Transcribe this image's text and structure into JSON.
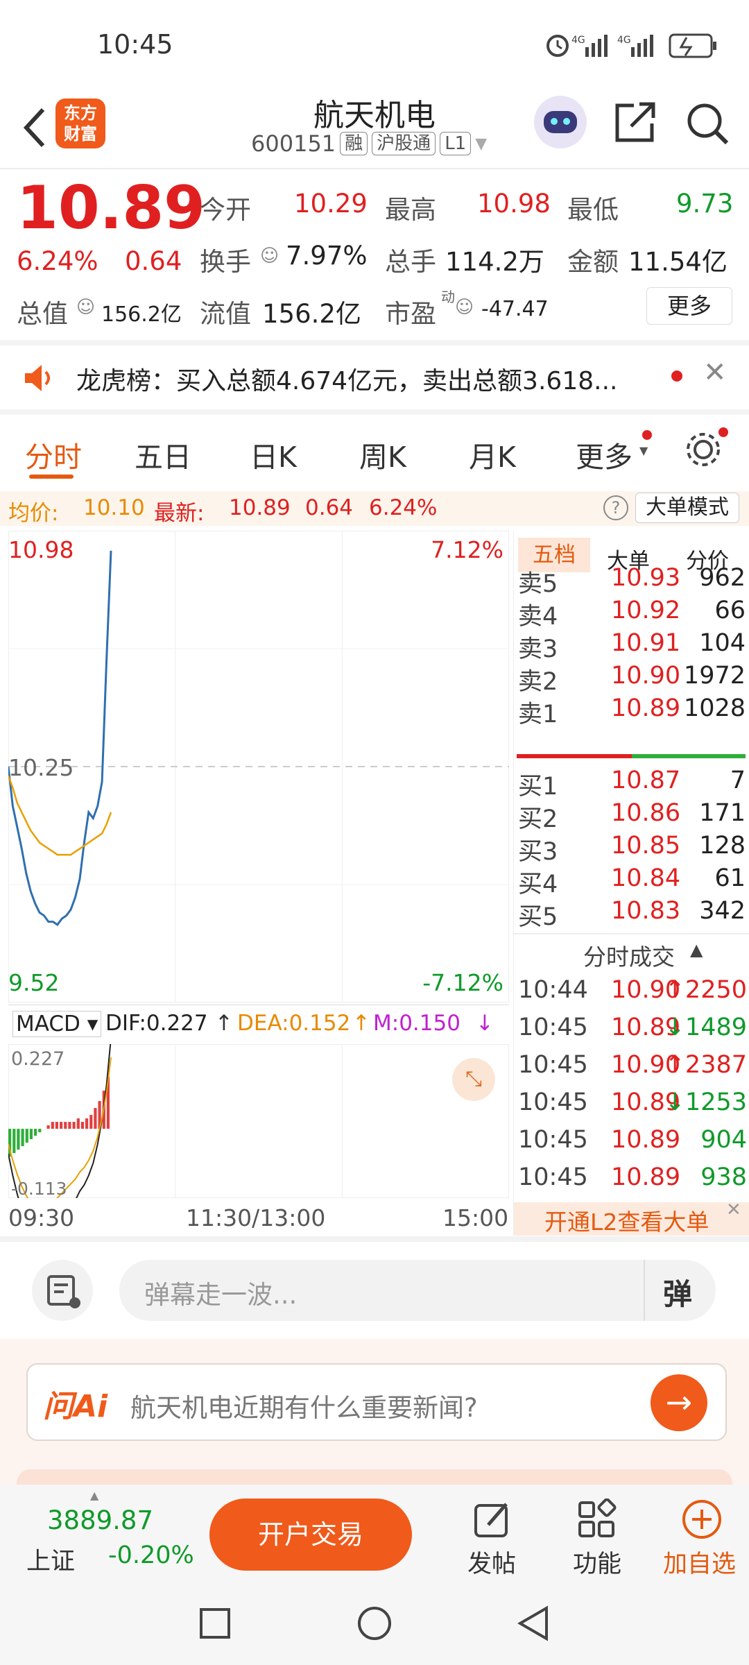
{
  "status_bar": {
    "time": "10:45",
    "signal1": "4G",
    "signal2": "4G"
  },
  "header": {
    "logo_line1": "东方",
    "logo_line2": "财富",
    "title": "航天机电",
    "code": "600151",
    "tags": [
      "融",
      "沪股通",
      "L1"
    ]
  },
  "quote": {
    "price": "10.89",
    "change_pct": "6.24%",
    "change": "0.64",
    "open_label": "今开",
    "open": "10.29",
    "high_label": "最高",
    "high": "10.98",
    "low_label": "最低",
    "low": "9.73",
    "turnover_label": "换手",
    "turnover": "7.97%",
    "volume_label": "总手",
    "volume": "114.2万",
    "amount_label": "金额",
    "amount": "11.54亿",
    "mcap_label": "总值",
    "mcap": "156.2亿",
    "float_label": "流值",
    "float": "156.2亿",
    "pe_label": "市盈",
    "pe_sup": "动",
    "pe": "-47.47",
    "more_btn": "更多"
  },
  "notice": {
    "text": "龙虎榜：买入总额4.674亿元，卖出总额3.618..."
  },
  "tabs": [
    "分时",
    "五日",
    "日K",
    "周K",
    "月K",
    "更多"
  ],
  "info_row": {
    "avg_label": "均价:",
    "avg": "10.10",
    "last_label": "最新:",
    "last": "10.89",
    "chg": "0.64",
    "pct": "6.24%",
    "mode_btn": "大单模式"
  },
  "chart_data": {
    "type": "line",
    "y_top": "10.98",
    "y_mid": "10.25",
    "y_bottom": "9.52",
    "pct_top": "7.12%",
    "pct_bottom": "-7.12%",
    "x_labels": [
      "09:30",
      "11:30/13:00",
      "15:00"
    ],
    "ylim": [
      9.52,
      10.98
    ],
    "series": [
      {
        "values": [
          10.25,
          10.12,
          10.05,
          9.98,
          9.9,
          9.84,
          9.8,
          9.77,
          9.76,
          9.74,
          9.74,
          9.73,
          9.75,
          9.76,
          9.78,
          9.82,
          9.88,
          10.0,
          10.1,
          10.08,
          10.12,
          10.2,
          10.6,
          10.96
        ],
        "color": "#2f6fb0"
      },
      {
        "values": [
          10.22,
          10.18,
          10.13,
          10.1,
          10.07,
          10.04,
          10.02,
          10.0,
          9.99,
          9.98,
          9.97,
          9.96,
          9.96,
          9.96,
          9.96,
          9.97,
          9.98,
          9.99,
          10.0,
          10.01,
          10.02,
          10.03,
          10.06,
          10.1
        ],
        "color": "#e8a000"
      }
    ],
    "macd": {
      "label": "MACD",
      "dif_label": "DIF:0.227",
      "dea_label": "DEA:0.152",
      "m_label": "M:0.150",
      "top": "0.227",
      "bottom": "-0.113",
      "hist": [
        -0.08,
        -0.07,
        -0.06,
        -0.05,
        -0.04,
        -0.03,
        -0.02,
        -0.01,
        0.0,
        0.01,
        0.02,
        0.02,
        0.02,
        0.02,
        0.02,
        0.02,
        0.03,
        0.02,
        0.03,
        0.04,
        0.06,
        0.08,
        0.11,
        0.15
      ]
    }
  },
  "orderbook": {
    "tabs": [
      "五档",
      "大单",
      "分价"
    ],
    "asks": [
      {
        "label": "卖5",
        "price": "10.93",
        "vol": "962"
      },
      {
        "label": "卖4",
        "price": "10.92",
        "vol": "66"
      },
      {
        "label": "卖3",
        "price": "10.91",
        "vol": "104"
      },
      {
        "label": "卖2",
        "price": "10.90",
        "vol": "1972"
      },
      {
        "label": "卖1",
        "price": "10.89",
        "vol": "1028"
      }
    ],
    "bids": [
      {
        "label": "买1",
        "price": "10.87",
        "vol": "7"
      },
      {
        "label": "买2",
        "price": "10.86",
        "vol": "171"
      },
      {
        "label": "买3",
        "price": "10.85",
        "vol": "128"
      },
      {
        "label": "买4",
        "price": "10.84",
        "vol": "61"
      },
      {
        "label": "买5",
        "price": "10.83",
        "vol": "342"
      }
    ],
    "trades_title": "分时成交",
    "trades": [
      {
        "time": "10:44",
        "price": "10.90",
        "vol": "↑2250",
        "dir": "up"
      },
      {
        "time": "10:45",
        "price": "10.89",
        "vol": "↓1489",
        "dir": "down"
      },
      {
        "time": "10:45",
        "price": "10.90",
        "vol": "↑2387",
        "dir": "up"
      },
      {
        "time": "10:45",
        "price": "10.89",
        "vol": "↓1253",
        "dir": "down"
      },
      {
        "time": "10:45",
        "price": "10.89",
        "vol": "904",
        "dir": "none"
      },
      {
        "time": "10:45",
        "price": "10.89",
        "vol": "938",
        "dir": "none"
      }
    ],
    "l2_banner": "开通L2查看大单"
  },
  "chat": {
    "placeholder": "弹幕走一波...",
    "danmu_btn": "弹"
  },
  "ai": {
    "brand": "问Ai",
    "question": "航天机电近期有什么重要新闻?"
  },
  "bottom": {
    "index_value": "3889.87",
    "index_name": "上证",
    "index_pct": "-0.20%",
    "trade_btn": "开户交易",
    "post": "发帖",
    "func": "功能",
    "add": "加自选"
  }
}
